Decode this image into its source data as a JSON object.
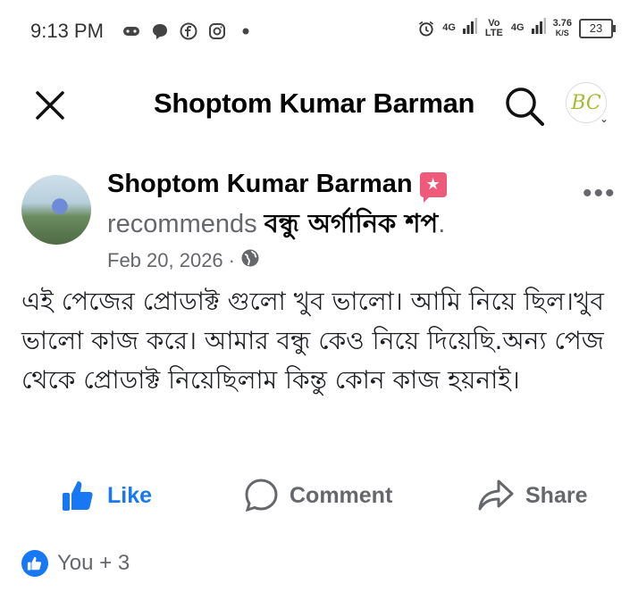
{
  "status_bar": {
    "time": "9:13 PM",
    "network_1": "4G",
    "volte": "Vo LTE",
    "network_2": "4G",
    "speed_value": "3.76",
    "speed_unit": "K/S",
    "battery": "23"
  },
  "header": {
    "title": "Shoptom Kumar Barman",
    "profile_logo": "BC"
  },
  "post": {
    "author": "Shoptom Kumar Barman",
    "recommends_text": "recommends ",
    "page_name": "বন্ধু অর্গানিক শপ",
    "page_suffix": ".",
    "date": "Feb 20, 2026",
    "separator": " · ",
    "more": "•••",
    "body": "এই পেজের প্রোডাক্ট গুলো খুব ভালো। আমি নিয়ে ছিল।খুব ভালো কাজ করে। আমার বন্ধু কেও নিয়ে দিয়েছি.অন্য পেজ থেকে প্রোডাক্ট নিয়েছিলাম কিন্তু কোন কাজ হয়নাই।"
  },
  "actions": {
    "like": "Like",
    "comment": "Comment",
    "share": "Share"
  },
  "reactions": {
    "summary": "You + 3"
  },
  "colors": {
    "accent": "#1877f2",
    "badge": "#ef5a7a",
    "secondary_text": "#65676b"
  }
}
